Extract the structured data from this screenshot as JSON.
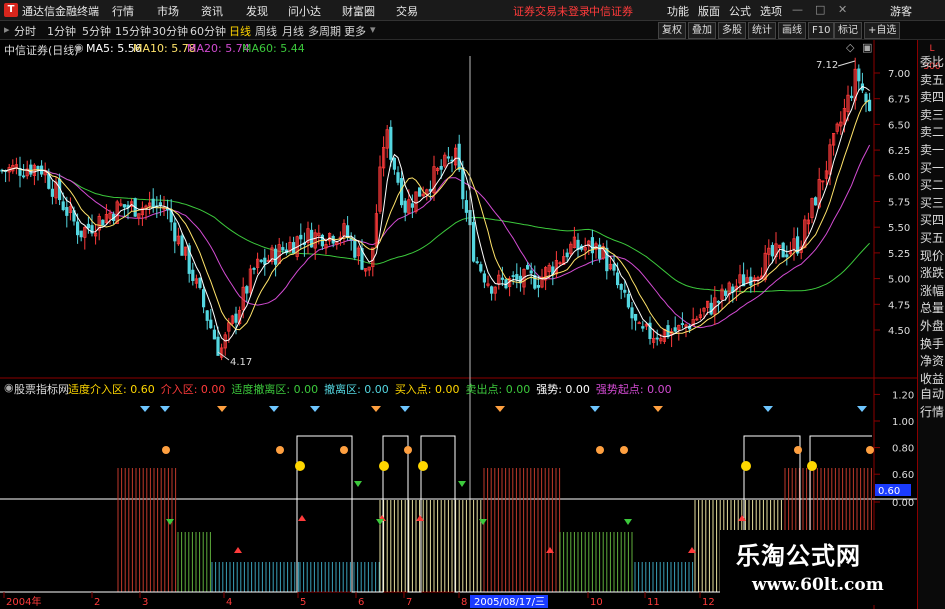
{
  "titlebar": {
    "app_name": "通达信金融终端",
    "menu": [
      "行情",
      "市场",
      "资讯",
      "发现",
      "问小达",
      "财富圈",
      "交易"
    ],
    "status_login": "证券交易未登录",
    "broker": "中信证券",
    "right_menu": [
      "功能",
      "版面",
      "公式",
      "选项"
    ],
    "guest": "游客"
  },
  "toolbar": {
    "periods": [
      "分时",
      "1分钟",
      "5分钟",
      "15分钟",
      "30分钟",
      "60分钟",
      "日线",
      "周线",
      "月线",
      "多周期",
      "更多"
    ],
    "active_period": "日线",
    "right_buttons": [
      "复权",
      "叠加",
      "多股",
      "统计",
      "画线",
      "F10",
      "标记",
      "+自选"
    ]
  },
  "main_chart": {
    "title": "中信证券(日线)",
    "ma5_label": "MA5: 5.56",
    "ma10_label": "MA10: 5.78",
    "ma20_label": "MA20: 5.74",
    "ma60_label": "MA60: 5.44",
    "high_label": "7.12",
    "low_label": "4.17",
    "y_ticks": [
      "7.00",
      "6.75",
      "6.50",
      "6.25",
      "6.00",
      "5.75",
      "5.50",
      "5.25",
      "5.00",
      "4.75",
      "4.50"
    ],
    "colors": {
      "up": "#ff3b3b",
      "down": "#54d6e0",
      "ma5": "#ffffff",
      "ma10": "#ffe36a",
      "ma20": "#d24bd2",
      "ma60": "#3cc93c"
    }
  },
  "indicator": {
    "name": "股票指标网",
    "labels": [
      {
        "text": "适度介入区: 0.60",
        "color": "#ffd700"
      },
      {
        "text": "介入区: 0.00",
        "color": "#ff3b3b"
      },
      {
        "text": "适度撤离区: 0.00",
        "color": "#3cc93c"
      },
      {
        "text": "撤离区: 0.00",
        "color": "#54d6e0"
      },
      {
        "text": "买入点: 0.00",
        "color": "#ffd700"
      },
      {
        "text": "卖出点: 0.00",
        "color": "#3cc93c"
      },
      {
        "text": "强势: 0.00",
        "color": "#ffffff"
      },
      {
        "text": "强势起点: 0.00",
        "color": "#d24bd2"
      }
    ],
    "y_ticks": [
      "1.20",
      "1.00",
      "0.80",
      "0.60",
      "0.00"
    ],
    "current_value": "0.60"
  },
  "xaxis": {
    "labels": [
      "2004年",
      "2",
      "3",
      "4",
      "5",
      "6",
      "7",
      "8",
      "2005/08/17/三",
      "10",
      "11",
      "12"
    ]
  },
  "side_panel": {
    "items": [
      "委比",
      "卖五",
      "卖四",
      "卖三",
      "卖二",
      "卖一",
      "买一",
      "买二",
      "买三",
      "买四",
      "买五",
      "现价",
      "涨跌",
      "涨幅",
      "总量",
      "外盘",
      "换手",
      "净资",
      "收益"
    ],
    "bottom_items": [
      "自动",
      "行情"
    ]
  },
  "watermark": {
    "line1": "乐淘公式网",
    "line2": "www.60lt.com"
  }
}
